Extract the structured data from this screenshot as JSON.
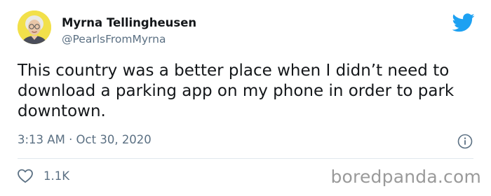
{
  "tweet": {
    "author": {
      "display_name": "Myrna Tellingheusen",
      "handle": "@PearlsFromMyrna"
    },
    "text": "This country was a better place when I didn’t need to download a parking app on my phone in order to park downtown.",
    "timestamp": "3:13 AM · Oct 30, 2020",
    "likes": "1.1K"
  },
  "watermark": "boredpanda.com",
  "icons": {
    "brand": "twitter-bird-icon",
    "info": "info-icon",
    "like": "heart-icon"
  },
  "colors": {
    "twitter_blue": "#1da1f2",
    "text": "#14171a",
    "secondary": "#5b7083",
    "divider": "#e1e8ed",
    "avatar_bg": "#f2e04a"
  }
}
